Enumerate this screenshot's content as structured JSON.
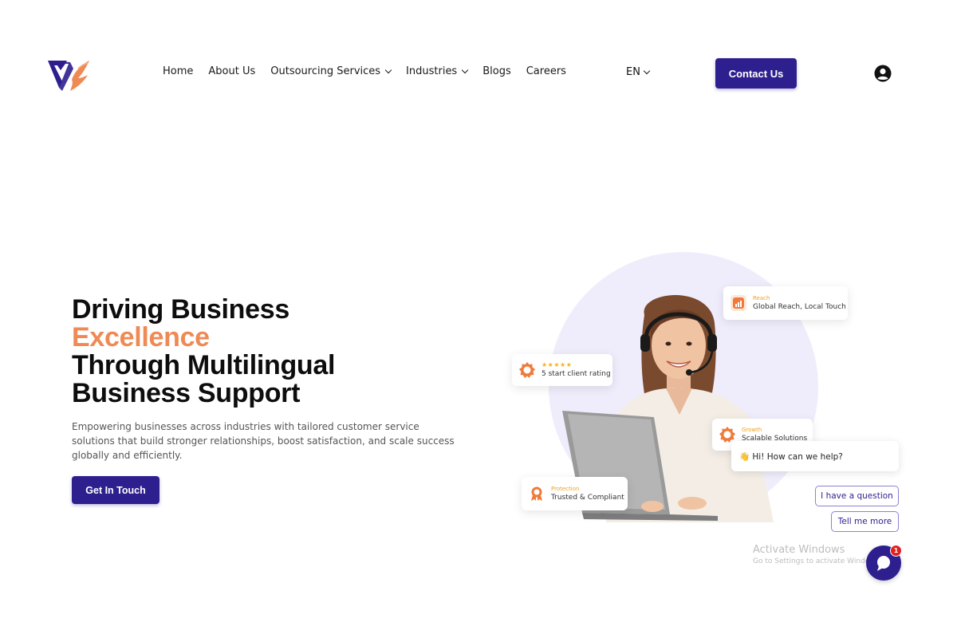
{
  "header": {
    "nav": [
      {
        "label": "Home"
      },
      {
        "label": "About Us"
      },
      {
        "label": "Outsourcing Services",
        "dropdown": true
      },
      {
        "label": "Industries",
        "dropdown": true
      },
      {
        "label": "Blogs"
      },
      {
        "label": "Careers"
      }
    ],
    "lang": "EN",
    "contact_label": "Contact Us"
  },
  "hero": {
    "title_line1": "Driving Business",
    "title_accent": "Excellence",
    "title_line3": "Through Multilingual",
    "title_line4": "Business Support",
    "description": "Empowering businesses across industries with tailored customer service solutions that build stronger relationships, boost satisfaction, and scale success globally and efficiently.",
    "cta_label": "Get In Touch"
  },
  "cards": {
    "reach": {
      "tag": "Reach",
      "text": "Global Reach, Local Touch"
    },
    "rating": {
      "stars": "★★★★★",
      "text": "5 start client rating"
    },
    "growth": {
      "tag": "Growth",
      "text": "Scalable Solutions"
    },
    "protection": {
      "tag": "Protection",
      "text": "Trusted & Compliant"
    }
  },
  "chat": {
    "greeting": "👋 Hi! How can we help?",
    "option1": "I have a question",
    "option2": "Tell me more",
    "badge_count": "1"
  },
  "watermark": {
    "title": "Activate Windows",
    "subtitle": "Go to Settings to activate Windows."
  },
  "colors": {
    "brand": "#2e1f8f",
    "accent": "#ef8a55"
  }
}
